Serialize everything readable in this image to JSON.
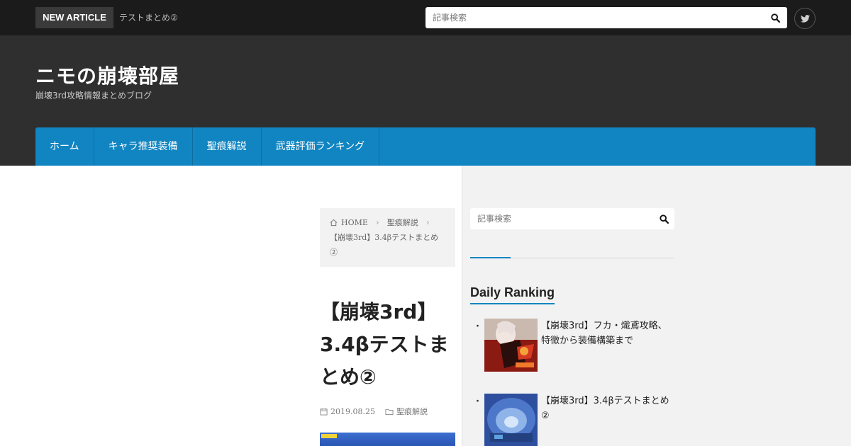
{
  "topbar": {
    "badge": "NEW ARTICLE",
    "ticker": "テストまとめ②",
    "search_placeholder": "記事検索",
    "search_icon": "search-icon",
    "twitter_icon": "twitter-icon"
  },
  "header": {
    "site_title": "ニモの崩壊部屋",
    "tagline": "崩壊3rd攻略情報まとめブログ"
  },
  "nav": {
    "items": [
      {
        "label": "ホーム"
      },
      {
        "label": "キャラ推奨装備"
      },
      {
        "label": "聖痕解説"
      },
      {
        "label": "武器評価ランキング"
      }
    ]
  },
  "breadcrumb": {
    "home_icon": "home-icon",
    "home": "HOME",
    "category": "聖痕解説",
    "current": "【崩壊3rd】3.4βテストまとめ②"
  },
  "article": {
    "title": "【崩壊3rd】3.4βテストまとめ②",
    "date_icon": "calendar-icon",
    "date": "2019.08.25",
    "category_icon": "folder-icon",
    "category": "聖痕解説"
  },
  "sidebar": {
    "search_placeholder": "記事検索",
    "widget_title": "Daily Ranking",
    "ranking": [
      {
        "bullet": "・",
        "title": "【崩壊3rd】フカ・熾鳶攻略、特徴から装備構築まで"
      },
      {
        "bullet": "・",
        "title": "【崩壊3rd】3.4βテストまとめ②"
      }
    ]
  },
  "colors": {
    "topbar": "#1b1b1b",
    "header": "#2f2f2f",
    "nav": "#1185c1",
    "sidebar": "#f2f2f2",
    "accent": "#1185c1"
  }
}
